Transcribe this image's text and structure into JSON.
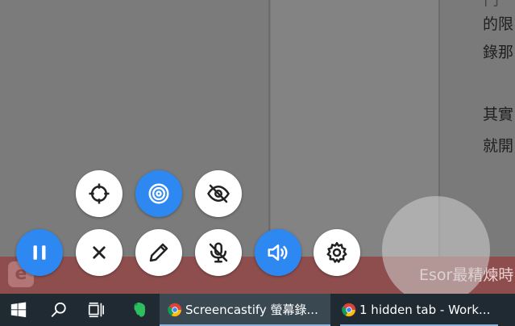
{
  "page": {
    "right_text_lines": [
      "的限",
      "錄那",
      "其實",
      "就開"
    ],
    "top_partial_char": "冂",
    "banner": {
      "logo_letter": "e",
      "text": "Esor最精煉時"
    }
  },
  "toolbar": {
    "row1": [
      {
        "icon": "crosshair-icon",
        "active": false
      },
      {
        "icon": "target-icon",
        "active": true
      },
      {
        "icon": "eye-off-icon",
        "active": false
      }
    ],
    "row2": [
      {
        "icon": "pause-icon",
        "active": true
      },
      {
        "icon": "close-icon",
        "active": false
      },
      {
        "icon": "pencil-icon",
        "active": false
      },
      {
        "icon": "mic-off-icon",
        "active": false
      },
      {
        "icon": "volume-icon",
        "active": true
      },
      {
        "icon": "gear-icon",
        "active": false
      }
    ],
    "accent_color": "#2d88f2"
  },
  "taskbar": {
    "icons": [
      "windows-start-icon",
      "search-icon",
      "task-view-icon",
      "evernote-icon"
    ],
    "tasks": [
      {
        "label": "Screencastify 螢幕錄...",
        "active": true
      },
      {
        "label": "1 hidden tab - Work...",
        "active": false
      }
    ]
  }
}
